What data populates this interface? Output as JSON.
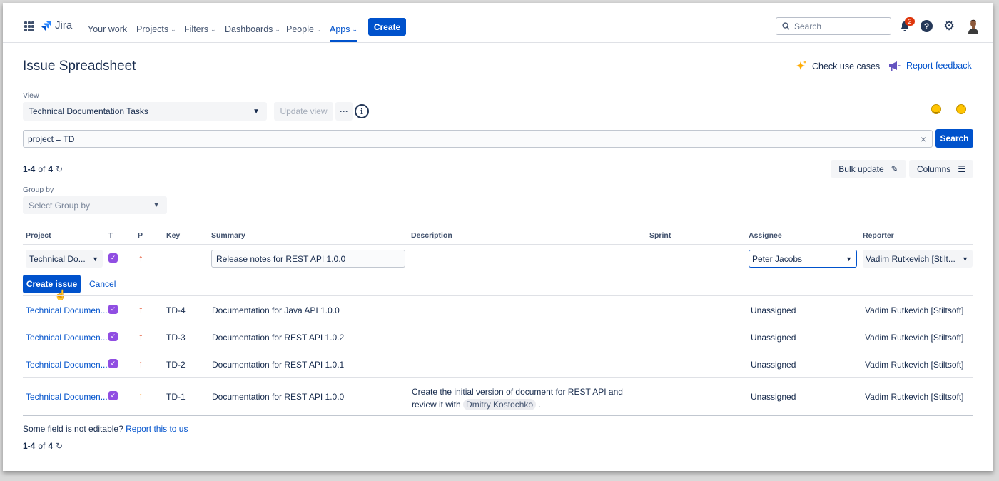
{
  "nav": {
    "logo_text": "Jira",
    "items": [
      {
        "label": "Your work",
        "chevron": false
      },
      {
        "label": "Projects",
        "chevron": true
      },
      {
        "label": "Filters",
        "chevron": true
      },
      {
        "label": "Dashboards",
        "chevron": true
      },
      {
        "label": "People",
        "chevron": true
      },
      {
        "label": "Apps",
        "chevron": true,
        "active": true
      }
    ],
    "create_label": "Create",
    "search_placeholder": "Search",
    "notification_count": "2",
    "help_glyph": "?",
    "icons": [
      "app-switcher-icon",
      "jira-logo-icon",
      "search-icon",
      "notification-icon",
      "help-icon",
      "settings-icon",
      "user-avatar"
    ]
  },
  "page": {
    "title": "Issue Spreadsheet",
    "check_use_cases": "Check use cases",
    "report_feedback": "Report feedback",
    "view_label": "View",
    "view_value": "Technical Documentation Tasks",
    "update_view": "Update view",
    "more_glyph": "···",
    "info_glyph": "i",
    "jql": "project = TD",
    "search_button": "Search",
    "count": {
      "range": "1-4",
      "of": "of",
      "total": "4"
    },
    "bulk_update": "Bulk update",
    "columns": "Columns",
    "group_by_label": "Group by",
    "group_by_placeholder": "Select Group by"
  },
  "table": {
    "headers": {
      "project": "Project",
      "type": "T",
      "priority": "P",
      "key": "Key",
      "summary": "Summary",
      "description": "Description",
      "sprint": "Sprint",
      "assignee": "Assignee",
      "reporter": "Reporter"
    },
    "new_row": {
      "project": "Technical Do...",
      "summary": "Release notes for REST API 1.0.0",
      "assignee": "Peter Jacobs",
      "reporter": "Vadim Rutkevich [Stilt...",
      "create_button": "Create issue",
      "cancel": "Cancel"
    },
    "rows": [
      {
        "project": "Technical Documen...",
        "key": "TD-4",
        "summary": "Documentation for Java API 1.0.0",
        "description": "",
        "description_mention": "",
        "description_end": "",
        "assignee": "Unassigned",
        "reporter": "Vadim Rutkevich [Stiltsoft]",
        "priority": "high"
      },
      {
        "project": "Technical Documen...",
        "key": "TD-3",
        "summary": "Documentation for REST API 1.0.2",
        "description": "",
        "description_mention": "",
        "description_end": "",
        "assignee": "Unassigned",
        "reporter": "Vadim Rutkevich [Stiltsoft]",
        "priority": "high"
      },
      {
        "project": "Technical Documen...",
        "key": "TD-2",
        "summary": "Documentation for REST API 1.0.1",
        "description": "",
        "description_mention": "",
        "description_end": "",
        "assignee": "Unassigned",
        "reporter": "Vadim Rutkevich [Stiltsoft]",
        "priority": "high"
      },
      {
        "project": "Technical Documen...",
        "key": "TD-1",
        "summary": "Documentation for REST API 1.0.0",
        "description": "Create the initial version of document for REST API and review it with",
        "description_mention": "Dmitry Kostochko",
        "description_end": ".",
        "assignee": "Unassigned",
        "reporter": "Vadim Rutkevich [Stiltsoft]",
        "priority": "medium"
      }
    ]
  },
  "footer": {
    "note": "Some field is not editable?",
    "link": "Report this to us",
    "count": {
      "range": "1-4",
      "of": "of",
      "total": "4"
    }
  },
  "colors": {
    "brand": "#0052cc",
    "high_priority": "#de350b",
    "medium_priority": "#ff8b00",
    "issue_type": "#904ee2"
  }
}
